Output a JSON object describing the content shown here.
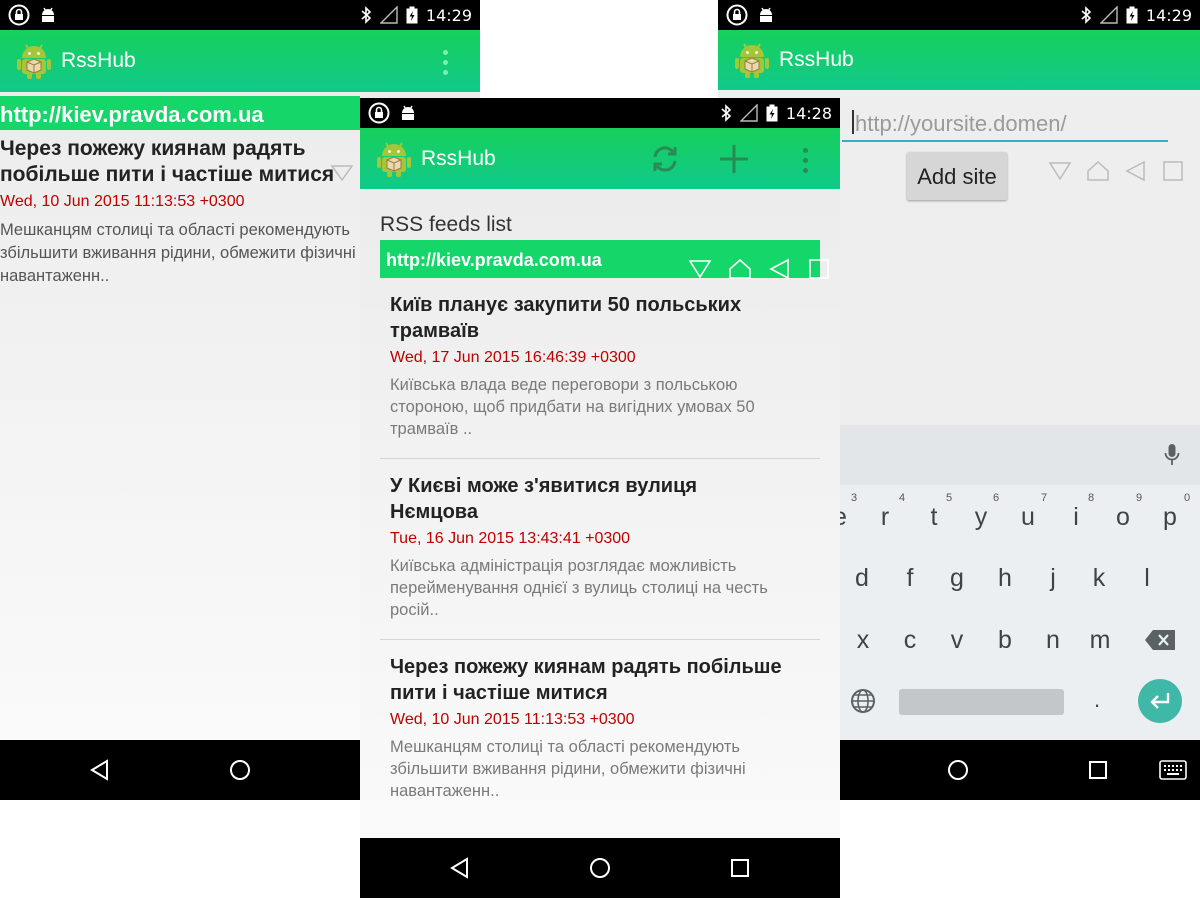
{
  "status": {
    "screen1_time": "14:29",
    "screen2_time": "14:28",
    "screen3_time": "14:29"
  },
  "app": {
    "name": "RssHub"
  },
  "screen1": {
    "feed_url": "http://kiev.pravda.com.ua",
    "article": {
      "title": "Через пожежу киянам радять побільше пити і частіше митися",
      "date": "Wed, 10 Jun 2015 11:13:53 +0300",
      "description": "Мешканцям столиці та області рекомендують збільшити вживання рідини, обмежити фізичні навантаженн.."
    }
  },
  "screen2": {
    "list_label": "RSS feeds list",
    "feed_url": "http://kiev.pravda.com.ua",
    "articles": [
      {
        "title": "Київ планує закупити 50 польських трамваїв",
        "date": "Wed, 17 Jun 2015 16:46:39 +0300",
        "description": "Київська влада веде переговори з польською стороною, щоб придбати на вигідних умовах 50 трамваїв .."
      },
      {
        "title": "У Києві може з'явитися вулиця Нємцова",
        "date": "Tue, 16 Jun 2015 13:43:41 +0300",
        "description": "Київська адміністрація розглядає можливість перейменування однієї з вулиць столиці на честь росій.."
      },
      {
        "title": "Через пожежу киянам радять побільше пити і частіше митися",
        "date": "Wed, 10 Jun 2015 11:13:53 +0300",
        "description": "Мешканцям столиці та області рекомендують збільшити вживання рідини, обмежити фізичні навантаженн.."
      }
    ]
  },
  "screen3": {
    "url_placeholder": "http://yoursite.domen/",
    "add_button": "Add site",
    "keyboard": {
      "row1": [
        "e",
        "r",
        "t",
        "y",
        "u",
        "i",
        "o",
        "p"
      ],
      "row1_numbers": [
        "3",
        "4",
        "5",
        "6",
        "7",
        "8",
        "9",
        "0"
      ],
      "row2": [
        "d",
        "f",
        "g",
        "h",
        "j",
        "k",
        "l"
      ],
      "row3": [
        "x",
        "c",
        "v",
        "b",
        "n",
        "m"
      ],
      "period": "."
    }
  },
  "colors": {
    "appbar": "#12cc72",
    "feed_header": "#15d669",
    "date": "#c00000",
    "fab": "#3fb8a8"
  }
}
